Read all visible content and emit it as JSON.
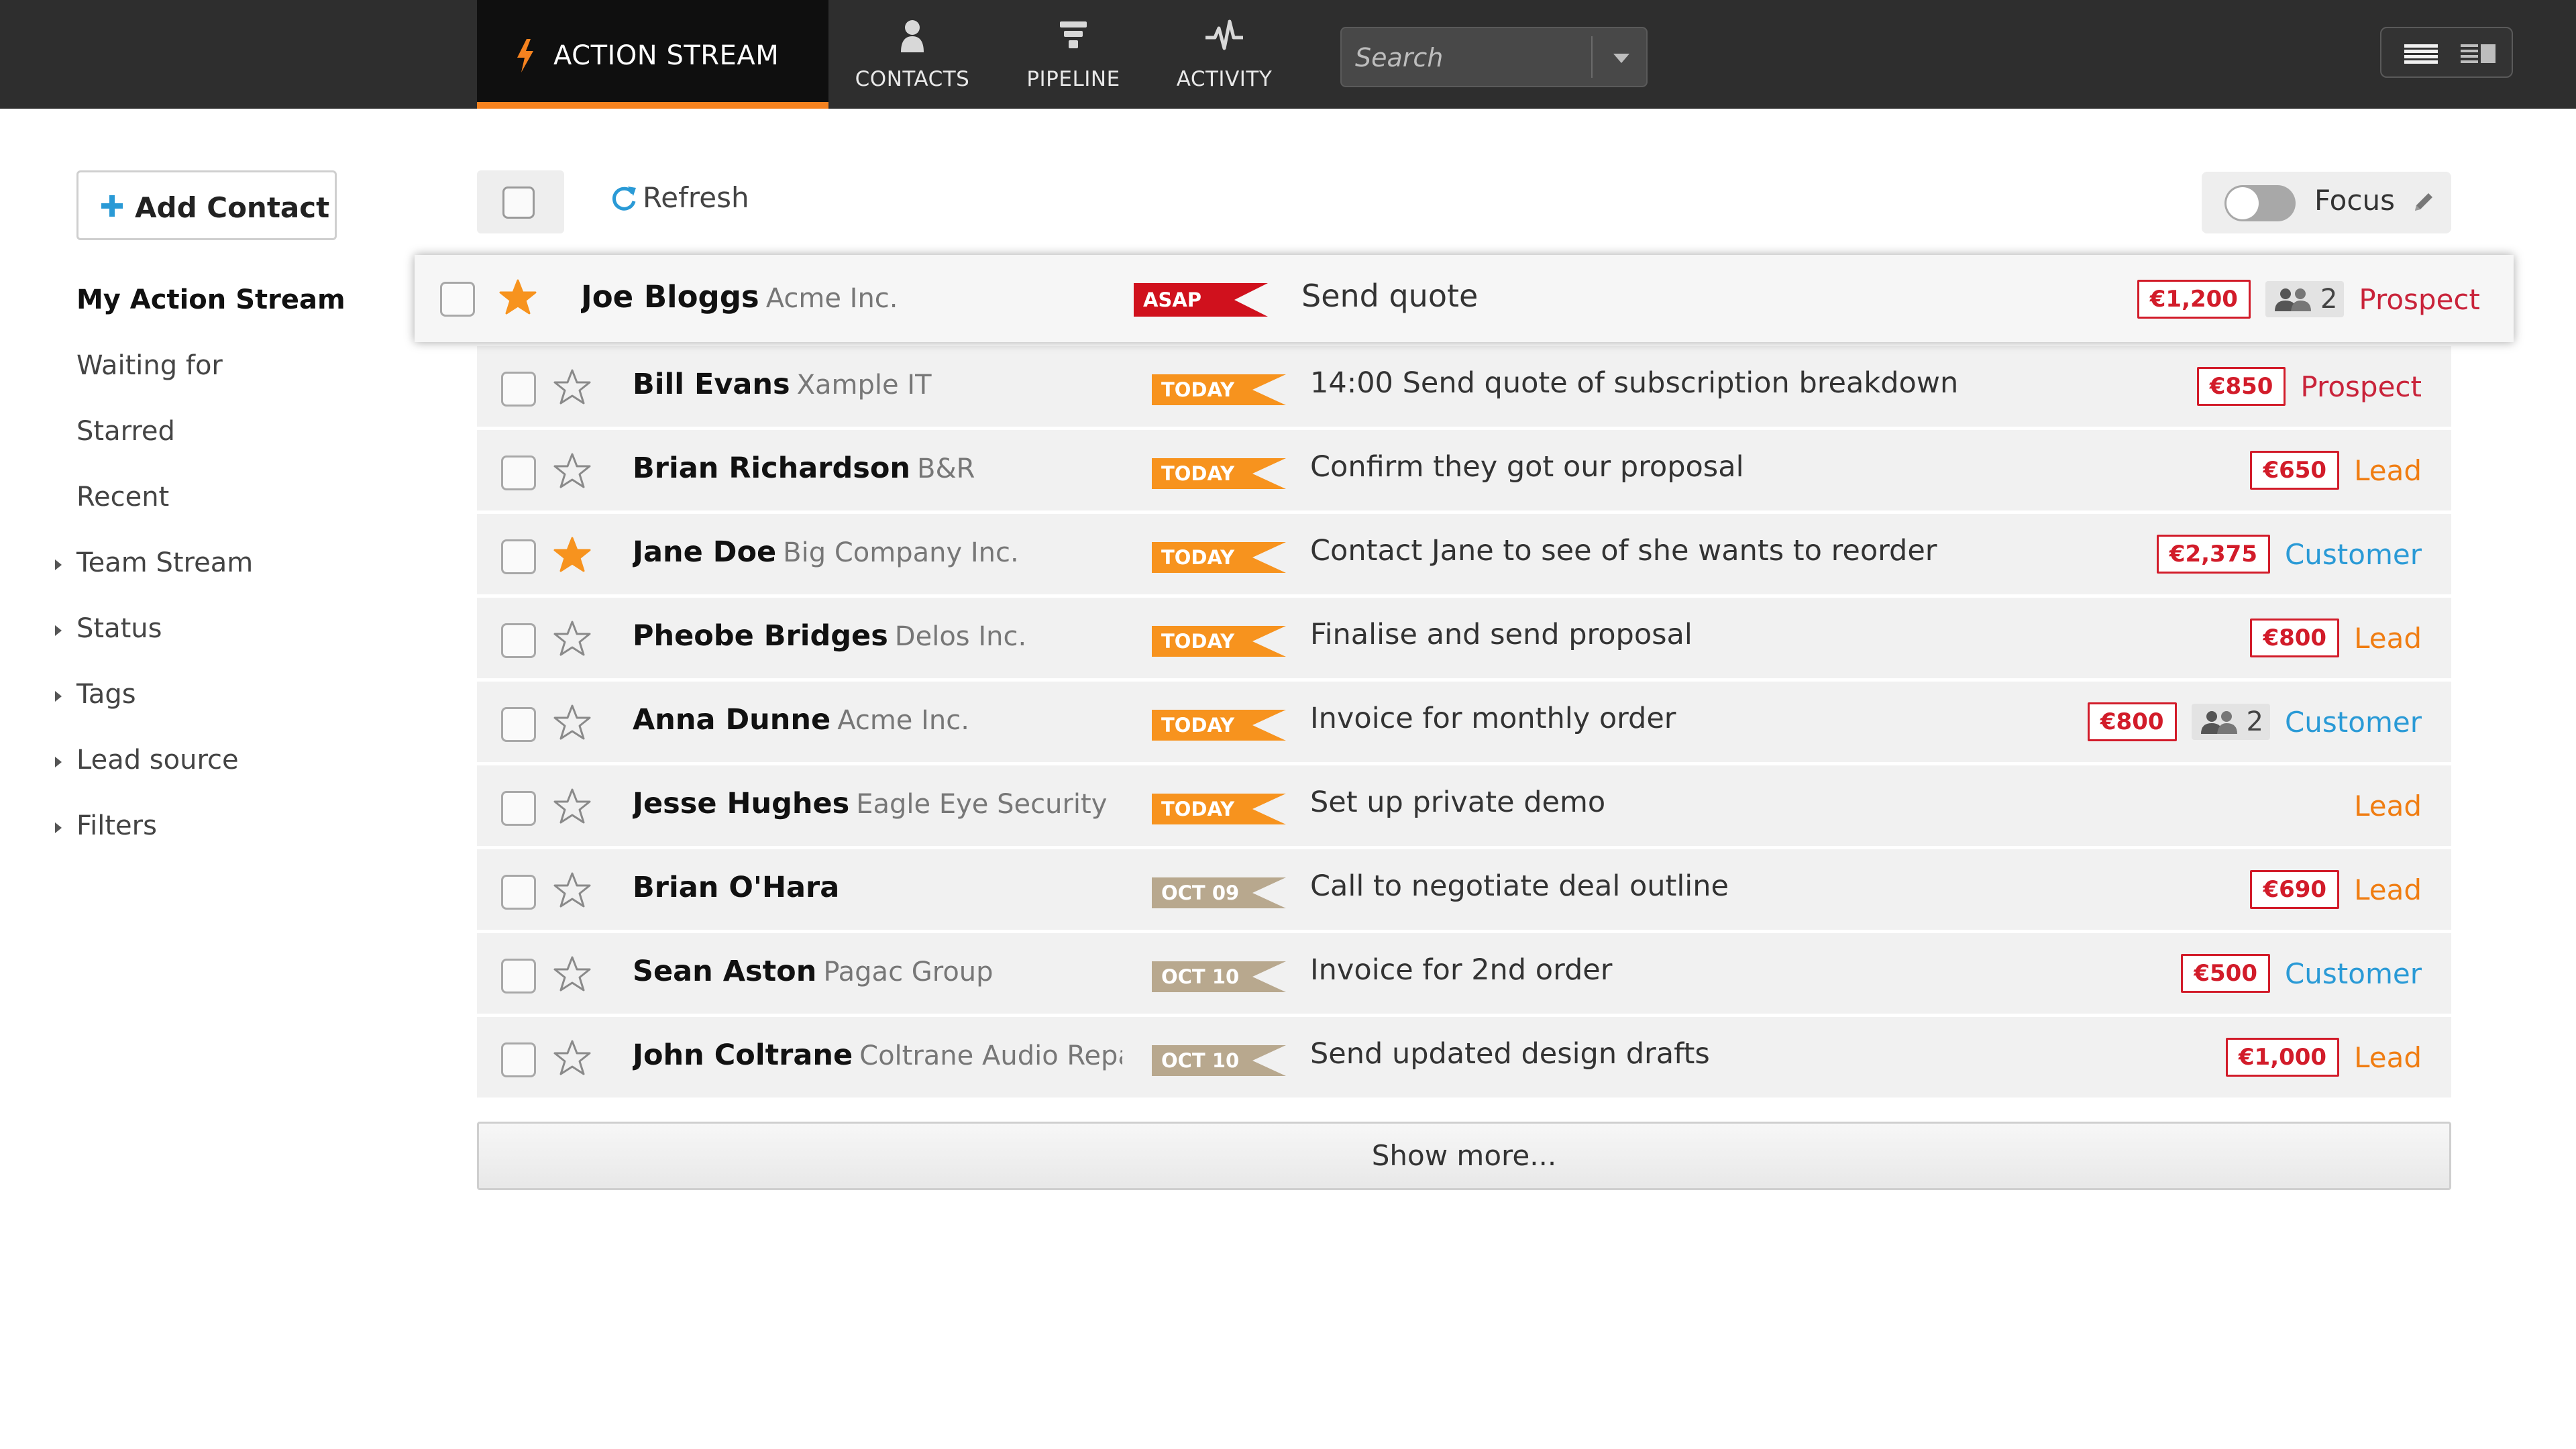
{
  "nav": {
    "action_stream": "ACTION STREAM",
    "contacts": "CONTACTS",
    "pipeline": "PIPELINE",
    "activity": "ACTIVITY",
    "search_placeholder": "Search"
  },
  "sidebar": {
    "add_contact": "Add Contact",
    "items": [
      {
        "label": "My Action Stream",
        "active": true
      },
      {
        "label": "Waiting for"
      },
      {
        "label": "Starred"
      },
      {
        "label": "Recent"
      },
      {
        "label": "Team Stream",
        "expandable": true
      },
      {
        "label": "Status",
        "expandable": true
      },
      {
        "label": "Tags",
        "expandable": true
      },
      {
        "label": "Lead source",
        "expandable": true
      },
      {
        "label": "Filters",
        "expandable": true
      }
    ]
  },
  "toolbar": {
    "refresh": "Refresh",
    "focus": "Focus",
    "focus_on": false
  },
  "colors": {
    "accent": "#f5821f",
    "asap": "#d0111d",
    "today": "#f7931e",
    "future_date": "#b8a88e",
    "prospect": "#c9233a",
    "lead": "#f07d12",
    "customer": "#2a9ad6",
    "star": "#f7931e"
  },
  "rows": [
    {
      "name": "Joe Bloggs",
      "company": "Acme Inc.",
      "tag": "ASAP",
      "task": "Send quote",
      "amount": "€1,200",
      "people": "2",
      "status": "Prospect",
      "starred": true
    },
    {
      "name": "Bill Evans",
      "company": "Xample IT",
      "tag": "TODAY",
      "task": "14:00 Send quote of subscription breakdown",
      "amount": "€850",
      "status": "Prospect",
      "starred": false
    },
    {
      "name": "Brian Richardson",
      "company": "B&R",
      "tag": "TODAY",
      "task": "Confirm they got our proposal",
      "amount": "€650",
      "status": "Lead",
      "starred": false
    },
    {
      "name": "Jane Doe",
      "company": "Big Company Inc.",
      "tag": "TODAY",
      "task": "Contact Jane to see of she wants to reorder",
      "amount": "€2,375",
      "status": "Customer",
      "starred": true
    },
    {
      "name": "Pheobe Bridges",
      "company": "Delos Inc.",
      "tag": "TODAY",
      "task": "Finalise and send proposal",
      "amount": "€800",
      "status": "Lead",
      "starred": false
    },
    {
      "name": "Anna Dunne",
      "company": "Acme Inc.",
      "tag": "TODAY",
      "task": "Invoice for monthly order",
      "amount": "€800",
      "people": "2",
      "status": "Customer",
      "starred": false
    },
    {
      "name": "Jesse Hughes",
      "company": "Eagle Eye Security",
      "tag": "TODAY",
      "task": "Set up private demo",
      "status": "Lead",
      "starred": false
    },
    {
      "name": "Brian O'Hara",
      "company": "",
      "tag": "OCT 09",
      "task": "Call to negotiate deal outline",
      "amount": "€690",
      "status": "Lead",
      "starred": false
    },
    {
      "name": "Sean Aston",
      "company": "Pagac Group",
      "tag": "OCT 10",
      "task": "Invoice for 2nd order",
      "amount": "€500",
      "status": "Customer",
      "starred": false
    },
    {
      "name": "John Coltrane",
      "company": "Coltrane Audio Repairs",
      "tag": "OCT 10",
      "task": "Send updated design drafts",
      "amount": "€1,000",
      "status": "Lead",
      "starred": false
    }
  ],
  "show_more": "Show more..."
}
